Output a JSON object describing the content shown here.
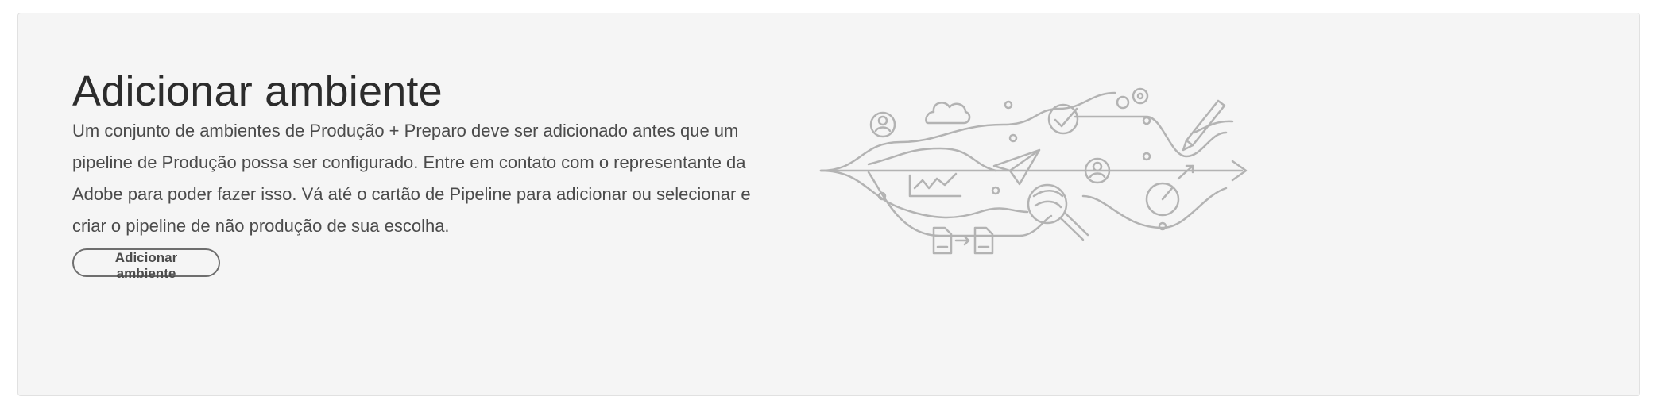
{
  "card": {
    "title": "Adicionar ambiente",
    "description": "Um conjunto de ambientes de Produção + Preparo deve ser adicionado antes que um pipeline de Produção possa ser configurado. Entre em contato com o representante da Adobe para poder fazer isso. Vá até o cartão de Pipeline para adicionar ou selecionar e criar o pipeline de não produção de sua escolha.",
    "button_label": "Adicionar ambiente"
  },
  "illustration": {
    "icons": [
      "user-icon",
      "cloud-icon",
      "checkmark-icon",
      "gear-icon",
      "pen-icon",
      "paper-plane-icon",
      "chart-icon",
      "user-icon",
      "magnifier-icon",
      "speedometer-icon",
      "document-icon",
      "document-icon",
      "arrow-right-icon"
    ],
    "stroke_color": "#b3b3b3"
  }
}
